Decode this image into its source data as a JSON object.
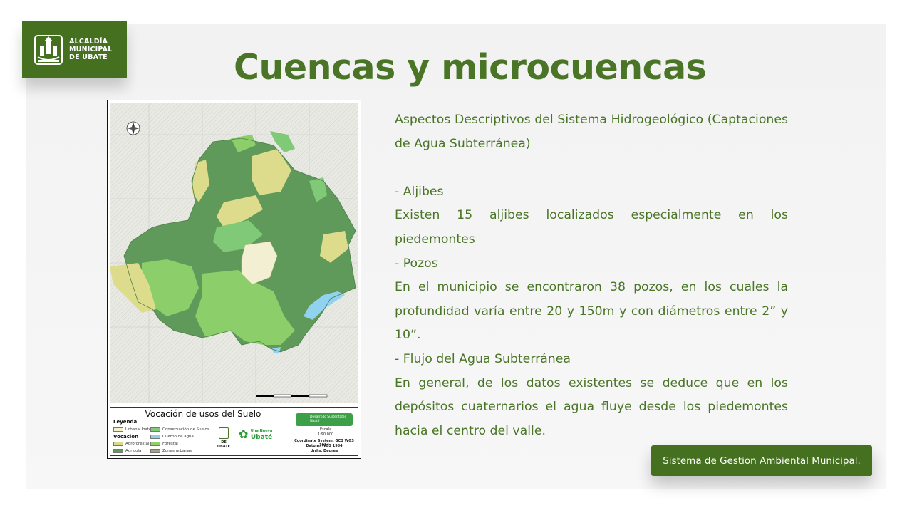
{
  "logo": {
    "line1": "ALCALDÍA",
    "line2": "MUNICIPAL",
    "line3": "DE UBATÉ"
  },
  "title": "Cuencas y microcuencas",
  "map": {
    "title": "Vocación de usos del Suelo",
    "legend_heading": "Leyenda",
    "vocacion_heading": "Vocacion",
    "items": [
      {
        "label": "UrbanaUbate",
        "color": "#f4f0d0"
      },
      {
        "label": "Agroforestal",
        "color": "#d8d98a"
      },
      {
        "label": "Agricola",
        "color": "#5f9a5a"
      },
      {
        "label": "Conservación de Suelos",
        "color": "#7fc977"
      },
      {
        "label": "Cuerpo de agua",
        "color": "#8fd0ee"
      },
      {
        "label": "Forestal",
        "color": "#8ed06a"
      },
      {
        "label": "Zonas urbanas",
        "color": "#a8a380"
      }
    ],
    "badge": "Desarrollo Sustentable Ubaté",
    "brand_small": "DE UBATE",
    "brand_name_top": "Una Nueva",
    "brand_name": "Ubaté",
    "scale_label": "Escala",
    "scale_value": "1:90.000",
    "coord_system": "Coordinate System: GCS WGS 1984",
    "datum": "Datum: WGS 1984",
    "units": "Units: Degree",
    "colors": {
      "agricola": "#5f9a5a",
      "agroforestal": "#dcdc8c",
      "forestal": "#8ccf6a",
      "conservacion": "#7fc977",
      "urbana": "#f3efd2",
      "agua": "#90d2f0",
      "terrain": "#e9e9e4"
    }
  },
  "body": {
    "heading": "Aspectos Descriptivos del Sistema Hidrogeológico (Captaciones de Agua Subterránea)",
    "aljibes_label": "- Aljibes",
    "aljibes_text": "Existen 15 aljibes localizados especialmente en los piedemontes",
    "pozos_label": "- Pozos",
    "pozos_text": "En el municipio se encontraron 38 pozos, en los cuales la profundidad varía entre 20 y 150m y con diámetros entre 2” y 10”.",
    "flujo_label": "- Flujo del Agua Subterránea",
    "flujo_text": "En general, de los datos existentes se deduce que en los depósitos cuaternarios el agua fluye desde los piedemontes hacia el centro del valle."
  },
  "footer": {
    "label": "Sistema de Gestion Ambiental Municipal."
  }
}
